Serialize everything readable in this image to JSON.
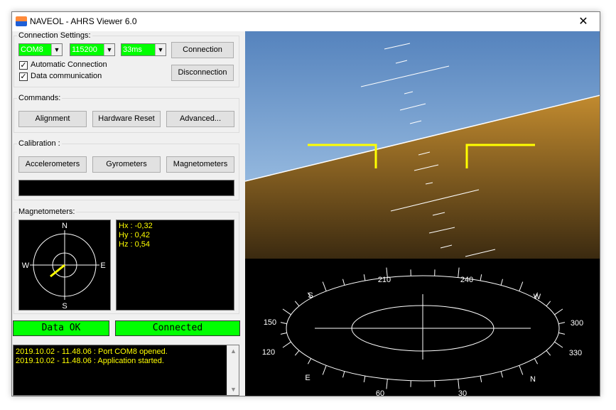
{
  "window": {
    "title": "NAVEOL - AHRS Viewer 6.0",
    "close_glyph": "✕"
  },
  "connection": {
    "group_title": "Connection Settings:",
    "port": "COM8",
    "baud": "115200",
    "interval": "33ms",
    "connect_label": "Connection",
    "disconnect_label": "Disconnection",
    "auto_connect_label": "Automatic Connection",
    "auto_connect_checked": true,
    "data_comm_label": "Data communication",
    "data_comm_checked": true,
    "combo_color": "#00ff00"
  },
  "commands": {
    "group_title": "Commands:",
    "alignment_label": "Alignment",
    "hardware_reset_label": "Hardware Reset",
    "advanced_label": "Advanced..."
  },
  "calibration": {
    "group_title": "Calibration :",
    "accelerometers_label": "Accelerometers",
    "gyrometers_label": "Gyrometers",
    "magnetometers_label": "Magnetometers"
  },
  "magnetometers": {
    "group_title": "Magnetometers:",
    "compass_labels": {
      "n": "N",
      "s": "S",
      "e": "E",
      "w": "W"
    },
    "hx": "Hx : -0,32",
    "hy": "Hy : 0,42",
    "hz": "Hz : 0,54",
    "value_color": "#ffff00"
  },
  "status": {
    "data_label": "Data OK",
    "connection_label": "Connected",
    "ok_color": "#00ff00"
  },
  "log": {
    "lines": [
      "2019.10.02 - 11.48.06 : Port COM8 opened.",
      "2019.10.02 - 11.48.06 : Application started."
    ],
    "text_color": "#ffff00",
    "scroll_up_glyph": "▲",
    "scroll_down_glyph": "▼"
  },
  "attitude": {
    "sky_color": "#5c8ec4",
    "ground_color": "#c08a2e",
    "marker_color": "#ffff00"
  },
  "heading": {
    "labels": {
      "h210": "210",
      "h240": "240",
      "s": "S",
      "w": "W",
      "h150": "150",
      "h300": "300",
      "h120": "120",
      "h330": "330",
      "e": "E",
      "n": "N",
      "h60": "60",
      "h30": "30"
    }
  }
}
